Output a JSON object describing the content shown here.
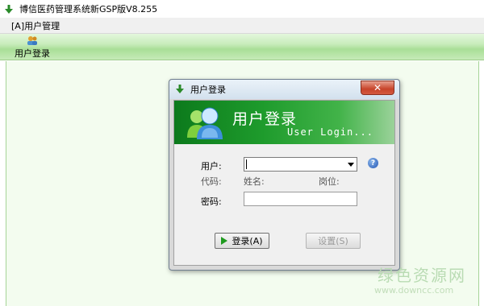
{
  "window": {
    "title": "博信医药管理系统新GSP版V8.255"
  },
  "menu": {
    "items": [
      {
        "label": "[A]用户管理"
      }
    ]
  },
  "toolbar": {
    "buttons": [
      {
        "label": "用户登录",
        "icon": "users-icon"
      }
    ]
  },
  "dialog": {
    "title": "用户登录",
    "close_glyph": "✕",
    "banner": {
      "title": "用户登录",
      "subtitle": "User Login..."
    },
    "user_label": "用户:",
    "user_value": "",
    "code_label": "代码:",
    "name_label": "姓名:",
    "post_label": "岗位:",
    "password_label": "密码:",
    "password_value": "",
    "login_button": "登录(A)",
    "settings_button": "设置(S)",
    "help_glyph": "?"
  },
  "watermark": {
    "title": "绿色资源网",
    "url": "www.downcc.com"
  },
  "colors": {
    "banner_green": "#1e9b2c",
    "toolbar_green": "#a9df97",
    "close_red": "#c7442a",
    "workspace_bg": "#f3fcef"
  }
}
